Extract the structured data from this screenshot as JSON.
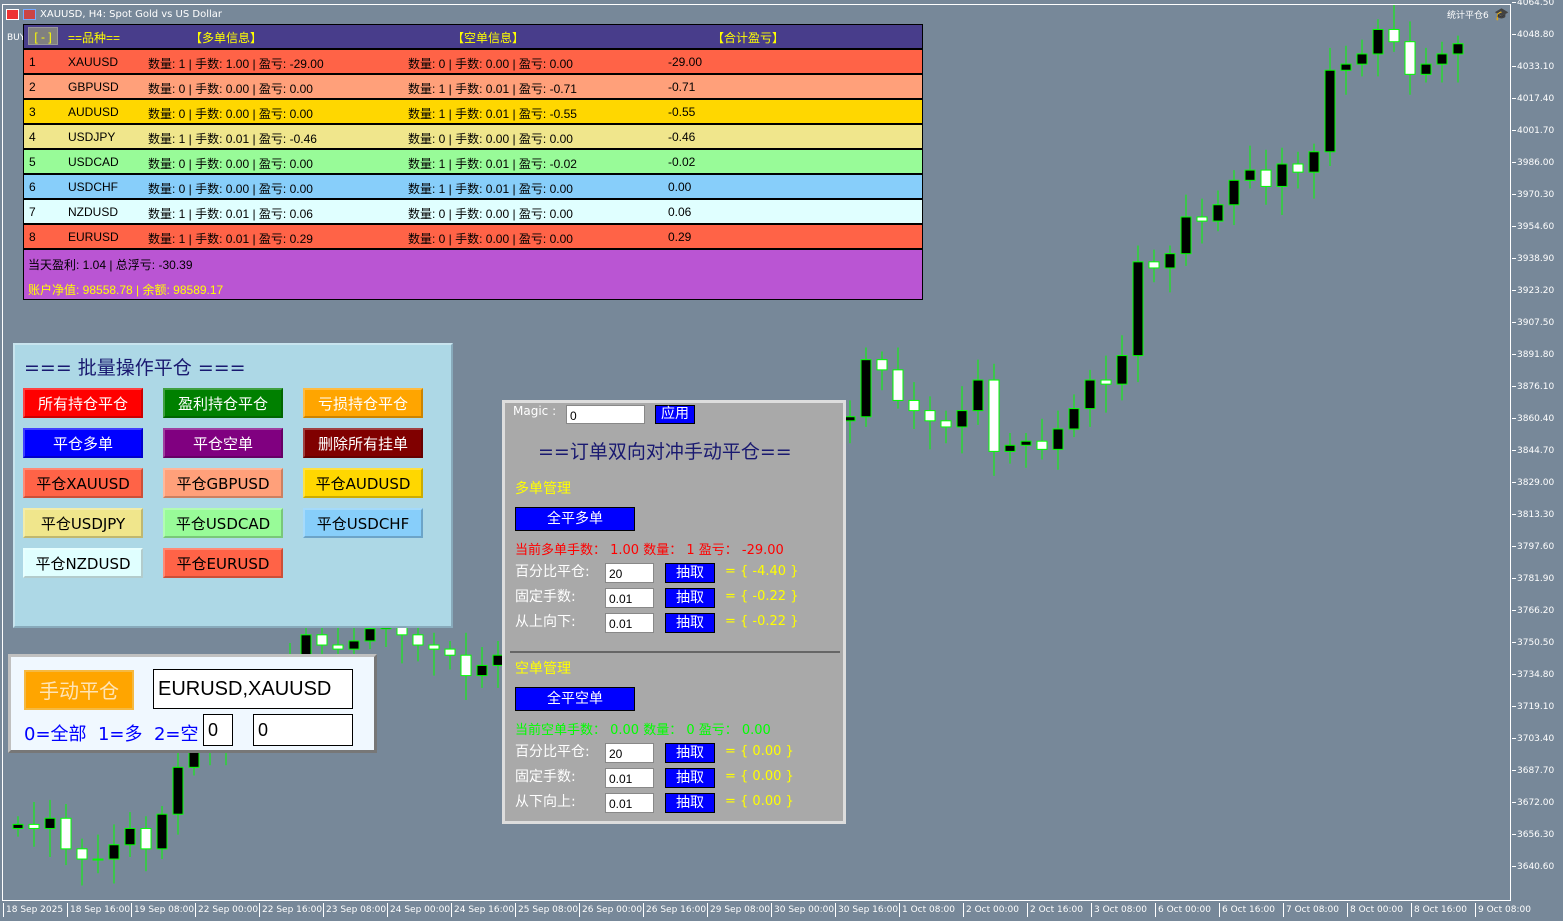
{
  "window": {
    "title": "XAUUSD, H4:  Spot Gold vs US Dollar",
    "bu_label": "BUY",
    "brand": "统计平仓6"
  },
  "price_axis": [
    "4064.50",
    "4048.80",
    "4033.10",
    "4017.40",
    "4001.70",
    "3986.00",
    "3970.30",
    "3954.60",
    "3938.90",
    "3923.20",
    "3907.50",
    "3891.80",
    "3876.10",
    "3860.40",
    "3844.70",
    "3829.00",
    "3813.30",
    "3797.60",
    "3781.90",
    "3766.20",
    "3750.50",
    "3734.80",
    "3719.10",
    "3703.40",
    "3687.70",
    "3672.00",
    "3656.30",
    "3640.60"
  ],
  "time_axis": [
    "18 Sep 2025",
    "18 Sep 16:00",
    "19 Sep 08:00",
    "22 Sep 00:00",
    "22 Sep 16:00",
    "23 Sep 08:00",
    "24 Sep 00:00",
    "24 Sep 16:00",
    "25 Sep 08:00",
    "26 Sep 00:00",
    "26 Sep 16:00",
    "29 Sep 08:00",
    "30 Sep 00:00",
    "30 Sep 16:00",
    "1 Oct 08:00",
    "2 Oct 00:00",
    "2 Oct 16:00",
    "3 Oct 08:00",
    "6 Oct 00:00",
    "6 Oct 16:00",
    "7 Oct 08:00",
    "8 Oct 00:00",
    "8 Oct 16:00",
    "9 Oct 08:00"
  ],
  "candles": {
    "price_max": 4064.5,
    "price_min": 3640.6,
    "closes": [
      3662,
      3660,
      3665,
      3650,
      3645,
      3645,
      3652,
      3660,
      3650,
      3667,
      3690,
      3700,
      3705,
      3710,
      3718,
      3725,
      3735,
      3745,
      3755,
      3750,
      3748,
      3752,
      3758,
      3760,
      3755,
      3750,
      3748,
      3745,
      3735,
      3740,
      3745,
      3742,
      3746,
      3750,
      3755,
      3760,
      3768,
      3775,
      3780,
      3790,
      3800,
      3805,
      3812,
      3818,
      3822,
      3828,
      3835,
      3840,
      3845,
      3850,
      3855,
      3860,
      3862,
      3890,
      3885,
      3870,
      3865,
      3860,
      3857,
      3865,
      3880,
      3845,
      3848,
      3850,
      3846,
      3856,
      3866,
      3880,
      3878,
      3892,
      3938,
      3935,
      3942,
      3960,
      3958,
      3966,
      3978,
      3983,
      3975,
      3986,
      3982,
      3992,
      4032,
      4035,
      4040,
      4052,
      4046,
      4030,
      4035,
      4040,
      4045
    ],
    "colors": {
      "up_body": "#000000",
      "down_body": "#ffffff",
      "wick": "#00ff00"
    }
  },
  "table": {
    "toggle": "[ - ]",
    "headers": {
      "symbol": "==品种==",
      "long": "【多单信息】",
      "short": "【空单信息】",
      "total": "【合计盈亏】"
    },
    "rows": [
      {
        "n": "1",
        "symbol": "XAUUSD",
        "long": "数量: 1 | 手数: 1.00 | 盈亏: -29.00",
        "short": "数量: 0 | 手数: 0.00 | 盈亏: 0.00",
        "total": "-29.00",
        "color": "#ff6347"
      },
      {
        "n": "2",
        "symbol": "GBPUSD",
        "long": "数量: 0 | 手数: 0.00 | 盈亏: 0.00",
        "short": "数量: 1 | 手数: 0.01 | 盈亏: -0.71",
        "total": "-0.71",
        "color": "#ffa07a"
      },
      {
        "n": "3",
        "symbol": "AUDUSD",
        "long": "数量: 0 | 手数: 0.00 | 盈亏: 0.00",
        "short": "数量: 1 | 手数: 0.01 | 盈亏: -0.55",
        "total": "-0.55",
        "color": "#ffd700"
      },
      {
        "n": "4",
        "symbol": "USDJPY",
        "long": "数量: 1 | 手数: 0.01 | 盈亏: -0.46",
        "short": "数量: 0 | 手数: 0.00 | 盈亏: 0.00",
        "total": "-0.46",
        "color": "#f0e68c"
      },
      {
        "n": "5",
        "symbol": "USDCAD",
        "long": "数量: 0 | 手数: 0.00 | 盈亏: 0.00",
        "short": "数量: 1 | 手数: 0.01 | 盈亏: -0.02",
        "total": "-0.02",
        "color": "#98fb98"
      },
      {
        "n": "6",
        "symbol": "USDCHF",
        "long": "数量: 0 | 手数: 0.00 | 盈亏: 0.00",
        "short": "数量: 1 | 手数: 0.01 | 盈亏: 0.00",
        "total": "0.00",
        "color": "#87cefa"
      },
      {
        "n": "7",
        "symbol": "NZDUSD",
        "long": "数量: 1 | 手数: 0.01 | 盈亏: 0.06",
        "short": "数量: 0 | 手数: 0.00 | 盈亏: 0.00",
        "total": "0.06",
        "color": "#e0ffff"
      },
      {
        "n": "8",
        "symbol": "EURUSD",
        "long": "数量: 1 | 手数: 0.01 | 盈亏: 0.29",
        "short": "数量: 0 | 手数: 0.00 | 盈亏: 0.00",
        "total": "0.29",
        "color": "#ff6347"
      }
    ],
    "summary": {
      "today": "当天盈利: 1.04 | 总浮亏: -30.39",
      "account": "账户净值: 98558.78 | 余额: 98589.17"
    }
  },
  "batch": {
    "title": "=== 批量操作平仓 ===",
    "buttons": [
      {
        "label": "所有持仓平仓",
        "bg": "#ff0000",
        "fg": "#ffffff"
      },
      {
        "label": "盈利持仓平仓",
        "bg": "#008000",
        "fg": "#ffffff"
      },
      {
        "label": "亏损持仓平仓",
        "bg": "#ffa500",
        "fg": "#ffffff"
      },
      {
        "label": "平仓多单",
        "bg": "#0000ff",
        "fg": "#ffffff"
      },
      {
        "label": "平仓空单",
        "bg": "#800080",
        "fg": "#ffffff"
      },
      {
        "label": "删除所有挂单",
        "bg": "#800000",
        "fg": "#ffffff"
      },
      {
        "label": "平仓XAUUSD",
        "bg": "#ff6347",
        "fg": "#000000"
      },
      {
        "label": "平仓GBPUSD",
        "bg": "#ffa07a",
        "fg": "#000000"
      },
      {
        "label": "平仓AUDUSD",
        "bg": "#ffd700",
        "fg": "#000000"
      },
      {
        "label": "平仓USDJPY",
        "bg": "#f0e68c",
        "fg": "#000000"
      },
      {
        "label": "平仓USDCAD",
        "bg": "#98fb98",
        "fg": "#000000"
      },
      {
        "label": "平仓USDCHF",
        "bg": "#87cefa",
        "fg": "#000000"
      },
      {
        "label": "平仓NZDUSD",
        "bg": "#e0ffff",
        "fg": "#000000"
      },
      {
        "label": "平仓EURUSD",
        "bg": "#ff6347",
        "fg": "#000000"
      }
    ]
  },
  "manual": {
    "button": "手动平仓",
    "symbols": "EURUSD,XAUUSD",
    "legend": "0=全部  1=多  2=空",
    "type_value": "0",
    "extra_value": "0"
  },
  "hedge": {
    "magic_label": "Magic :",
    "magic_value": "0",
    "apply": "应用",
    "title": "==订单双向对冲手动平仓==",
    "long": {
      "section": "多单管理",
      "close_all": "全平多单",
      "status": "当前多单手数： 1.00 数量： 1 盈亏： -29.00",
      "rows": [
        {
          "label": "百分比平仓:",
          "value": "20",
          "btn": "抽取",
          "result": "= { -4.40 }"
        },
        {
          "label": "固定手数:",
          "value": "0.01",
          "btn": "抽取",
          "result": "= { -0.22 }"
        },
        {
          "label": "从上向下:",
          "value": "0.01",
          "btn": "抽取",
          "result": "= { -0.22 }"
        }
      ]
    },
    "short": {
      "section": "空单管理",
      "close_all": "全平空单",
      "status": "当前空单手数： 0.00 数量： 0 盈亏： 0.00",
      "rows": [
        {
          "label": "百分比平仓:",
          "value": "20",
          "btn": "抽取",
          "result": "= { 0.00 }"
        },
        {
          "label": "固定手数:",
          "value": "0.01",
          "btn": "抽取",
          "result": "= { 0.00 }"
        },
        {
          "label": "从下向上:",
          "value": "0.01",
          "btn": "抽取",
          "result": "= { 0.00 }"
        }
      ]
    }
  }
}
